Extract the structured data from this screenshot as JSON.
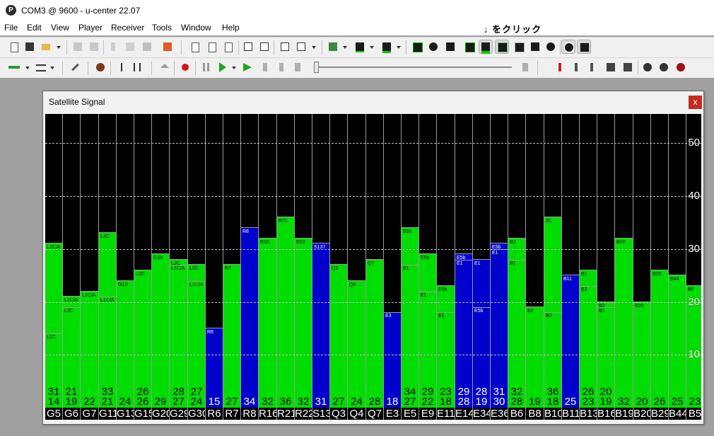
{
  "window_title": "COM3 @ 9600 - u-center 22.07",
  "app_logo": "P",
  "menu": [
    "File",
    "Edit",
    "View",
    "Player",
    "Receiver",
    "Tools",
    "Window",
    "Help"
  ],
  "annotation": "↓ をクリック",
  "child_window": {
    "title": "Satellite Signal",
    "close_label": "x"
  },
  "colors": {
    "green": "#00dd00",
    "blue": "#0000cc",
    "background": "#000000"
  },
  "axis": {
    "max": 55,
    "ticks": [
      50,
      40,
      30,
      20,
      10
    ]
  },
  "satellites": [
    {
      "name": "G5",
      "c": "green",
      "v": [
        31,
        14
      ],
      "lab": [
        "L1C/A",
        "L2C"
      ]
    },
    {
      "name": "G6",
      "c": "green",
      "v": [
        21,
        19
      ],
      "lab": [
        "L1C/A",
        "L2C"
      ]
    },
    {
      "name": "G7",
      "c": "green",
      "v": [
        22,
        null
      ],
      "lab": [
        "L1C/A",
        ""
      ]
    },
    {
      "name": "G11",
      "c": "green",
      "v": [
        33,
        21
      ],
      "lab": [
        "L2C",
        "L1C/A"
      ]
    },
    {
      "name": "G13",
      "c": "green",
      "v": [
        24,
        null
      ],
      "lab": [
        "G13",
        ""
      ]
    },
    {
      "name": "G15",
      "c": "green",
      "v": [
        26,
        26
      ],
      "lab": [
        "L2C",
        ""
      ]
    },
    {
      "name": "G20",
      "c": "green",
      "v": [
        29,
        null
      ],
      "lab": [
        "G20",
        ""
      ]
    },
    {
      "name": "G29",
      "c": "green",
      "v": [
        28,
        27
      ],
      "lab": [
        "L2C",
        "L1C/A"
      ]
    },
    {
      "name": "G30",
      "c": "green",
      "v": [
        27,
        24
      ],
      "lab": [
        "L2C",
        "L1C/A"
      ]
    },
    {
      "name": "R6",
      "c": "blue",
      "v": [
        15,
        null
      ],
      "lab": [
        "R6",
        ""
      ]
    },
    {
      "name": "R7",
      "c": "green",
      "v": [
        27,
        null
      ],
      "lab": [
        "R7",
        ""
      ]
    },
    {
      "name": "R8",
      "c": "blue",
      "v": [
        34,
        null
      ],
      "lab": [
        "R8",
        ""
      ]
    },
    {
      "name": "R16",
      "c": "green",
      "v": [
        32,
        null
      ],
      "lab": [
        "R16",
        ""
      ]
    },
    {
      "name": "R21",
      "c": "green",
      "v": [
        36,
        null
      ],
      "lab": [
        "R21",
        ""
      ]
    },
    {
      "name": "R22",
      "c": "green",
      "v": [
        32,
        null
      ],
      "lab": [
        "R22",
        ""
      ]
    },
    {
      "name": "S137",
      "c": "blue",
      "v": [
        31,
        null
      ],
      "lab": [
        "S137",
        ""
      ]
    },
    {
      "name": "Q3",
      "c": "green",
      "v": [
        27,
        null
      ],
      "lab": [
        "Q3",
        ""
      ]
    },
    {
      "name": "Q4",
      "c": "green",
      "v": [
        24,
        null
      ],
      "lab": [
        "Q4",
        ""
      ]
    },
    {
      "name": "Q7",
      "c": "green",
      "v": [
        28,
        null
      ],
      "lab": [
        "Q7",
        ""
      ]
    },
    {
      "name": "E3",
      "c": "blue",
      "v": [
        18,
        null
      ],
      "lab": [
        "E3",
        ""
      ]
    },
    {
      "name": "E5",
      "c": "green",
      "v": [
        34,
        27
      ],
      "lab": [
        "E5b",
        "E1"
      ]
    },
    {
      "name": "E9",
      "c": "green",
      "v": [
        29,
        22
      ],
      "lab": [
        "E5b",
        "E1"
      ]
    },
    {
      "name": "E11",
      "c": "green",
      "v": [
        23,
        18
      ],
      "lab": [
        "E5b",
        "E1"
      ]
    },
    {
      "name": "E14",
      "c": "blue",
      "v": [
        29,
        28
      ],
      "lab": [
        "E5b",
        "E1"
      ]
    },
    {
      "name": "E34",
      "c": "blue",
      "v": [
        28,
        19
      ],
      "lab": [
        "E1",
        "E5b"
      ]
    },
    {
      "name": "E36",
      "c": "blue",
      "v": [
        31,
        30
      ],
      "lab": [
        "E5b",
        "E1"
      ]
    },
    {
      "name": "B6",
      "c": "green",
      "v": [
        32,
        28
      ],
      "lab": [
        "B2",
        "B1"
      ]
    },
    {
      "name": "B8",
      "c": "green",
      "v": [
        19,
        null
      ],
      "lab": [
        "B2",
        ""
      ]
    },
    {
      "name": "B10",
      "c": "green",
      "v": [
        36,
        18
      ],
      "lab": [
        "B1",
        "B2"
      ]
    },
    {
      "name": "B11",
      "c": "blue",
      "v": [
        25,
        null
      ],
      "lab": [
        "B11",
        ""
      ]
    },
    {
      "name": "B13",
      "c": "green",
      "v": [
        26,
        23
      ],
      "lab": [
        "B1",
        "B2"
      ]
    },
    {
      "name": "B16",
      "c": "green",
      "v": [
        20,
        19
      ],
      "lab": [
        "B2",
        "B1"
      ]
    },
    {
      "name": "B19",
      "c": "green",
      "v": [
        32,
        null
      ],
      "lab": [
        "B19",
        ""
      ]
    },
    {
      "name": "B20",
      "c": "green",
      "v": [
        20,
        null
      ],
      "lab": [
        "B20",
        ""
      ]
    },
    {
      "name": "B29",
      "c": "green",
      "v": [
        26,
        null
      ],
      "lab": [
        "B29",
        ""
      ]
    },
    {
      "name": "B44",
      "c": "green",
      "v": [
        25,
        null
      ],
      "lab": [
        "B44",
        ""
      ]
    },
    {
      "name": "B5",
      "c": "green",
      "v": [
        23,
        null
      ],
      "lab": [
        "B5",
        ""
      ]
    }
  ]
}
